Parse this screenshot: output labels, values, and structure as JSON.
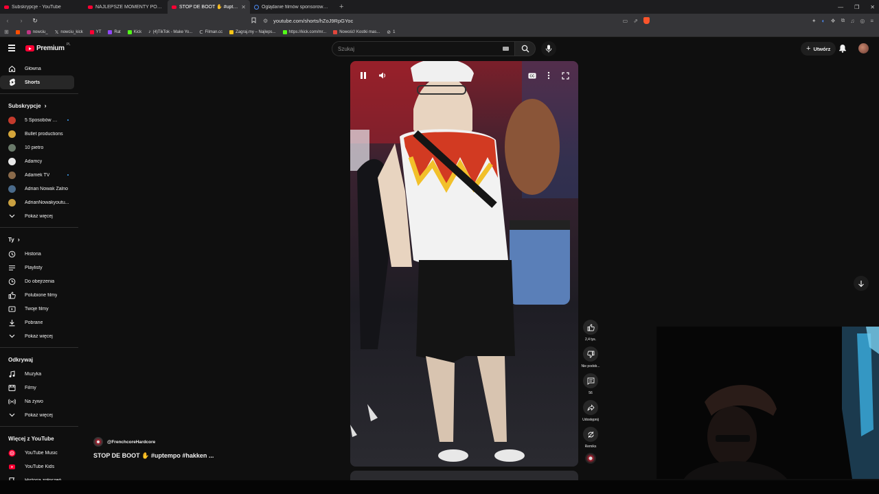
{
  "browser": {
    "tabs": [
      {
        "title": "Subskrypcje - YouTube",
        "icon": "youtube-favicon"
      },
      {
        "title": "NAJLEPSZE MOMENTY POLSKIEGO",
        "icon": "youtube-favicon"
      },
      {
        "title": "STOP DE BOOT ✋ #uptempo",
        "icon": "youtube-favicon",
        "active": true
      },
      {
        "title": "Oglądanie filmów sponsorowanych",
        "icon": "google-favicon"
      }
    ],
    "new_tab": "+",
    "url": "youtube.com/shorts/hZoJ9RpGYoc",
    "bookmarks": [
      "nowciu_",
      "nowciu_kick",
      "YT",
      "Rat",
      "Kick",
      "(4)TikTok - Make Yo...",
      "Filman.cc",
      "Zagraj.my – Najleps...",
      "https://kick.com/mr...",
      "Nowość! Kostki mas...",
      "1"
    ]
  },
  "topbar": {
    "logo_text": "Premium",
    "logo_country": "PL",
    "search_placeholder": "Szukaj",
    "create_label": "Utwórz"
  },
  "sidebar": {
    "main": [
      {
        "label": "Główna",
        "icon": "home-icon"
      },
      {
        "label": "Shorts",
        "icon": "shorts-icon",
        "active": true
      }
    ],
    "subs_header": "Subskrypcje",
    "subs": [
      {
        "label": "5 Sposobów na...",
        "color": "#c33a2c",
        "dot": true
      },
      {
        "label": "Bullet productions",
        "color": "#d4a53a",
        "dot": false
      },
      {
        "label": "10 pietro",
        "color": "#6a7a6a",
        "dot": false
      },
      {
        "label": "Adamcy",
        "color": "#e8e8e8",
        "dot": false
      },
      {
        "label": "Adamek TV",
        "color": "#8a6a4a",
        "dot": true
      },
      {
        "label": "Adrian Nowak Żalno",
        "color": "#4a6a8a",
        "dot": false
      },
      {
        "label": "AdrianNowakyoutu...",
        "color": "#c9a040",
        "dot": false
      }
    ],
    "show_more": "Pokaż więcej",
    "you_header": "Ty",
    "you": [
      {
        "label": "Historia",
        "icon": "history-icon"
      },
      {
        "label": "Playlisty",
        "icon": "playlist-icon"
      },
      {
        "label": "Do obejrzenia",
        "icon": "watch-later-icon"
      },
      {
        "label": "Polubione filmy",
        "icon": "like-icon"
      },
      {
        "label": "Twoje filmy",
        "icon": "your-videos-icon"
      },
      {
        "label": "Pobrane",
        "icon": "download-icon"
      },
      {
        "label": "Pokaż więcej",
        "icon": "chevron-down-icon"
      }
    ],
    "explore_header": "Odkrywaj",
    "explore": [
      {
        "label": "Muzyka",
        "icon": "music-icon"
      },
      {
        "label": "Filmy",
        "icon": "film-icon"
      },
      {
        "label": "Na żywo",
        "icon": "live-icon"
      },
      {
        "label": "Pokaż więcej",
        "icon": "chevron-down-icon"
      }
    ],
    "more_header": "Więcej z YouTube",
    "more": [
      {
        "label": "YouTube Music",
        "icon": "yt-music-icon"
      },
      {
        "label": "YouTube Kids",
        "icon": "yt-kids-icon"
      },
      {
        "label": "Historia zgłoszeń",
        "icon": "flag-icon"
      }
    ]
  },
  "short": {
    "channel": "@FrenchcoreHardcore",
    "title": "STOP DE BOOT ✋ #uptempo #hakken ..."
  },
  "actions": {
    "likes": "2,4 tys.",
    "dislike": "Nie podob...",
    "comments": "56",
    "share": "Udostępnij",
    "remix": "Remiks"
  },
  "colors": {
    "accent": "#ff0033",
    "background": "#0f0f0f",
    "link_blue": "#3ea6ff"
  }
}
